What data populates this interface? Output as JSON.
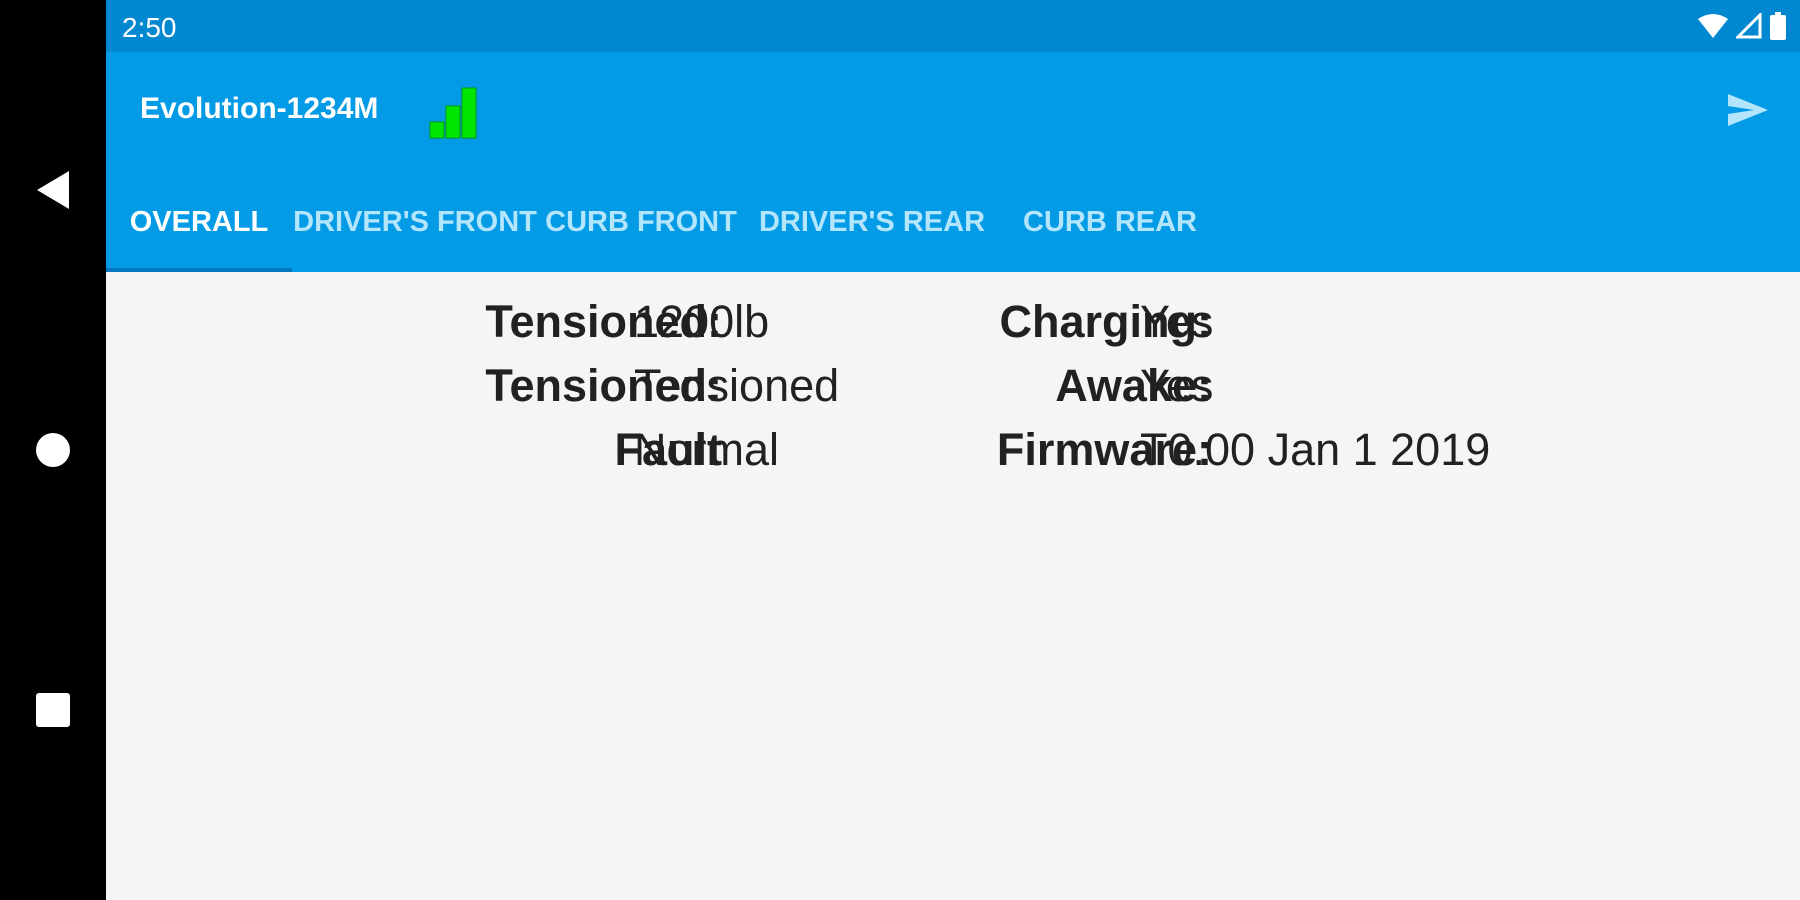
{
  "status_bar": {
    "time": "2:50",
    "icons": [
      "wifi-icon",
      "cell-signal-icon",
      "battery-icon"
    ]
  },
  "app_bar": {
    "title": "Evolution-1234M",
    "signal_icon": "signal-strength-icon",
    "signal_color": "#00e600",
    "action_icon": "send-icon"
  },
  "tabs": [
    {
      "label": "OVERALL",
      "active": true
    },
    {
      "label": "DRIVER'S FRONT",
      "active": false
    },
    {
      "label": "CURB FRONT",
      "active": false
    },
    {
      "label": "DRIVER'S REAR",
      "active": false
    },
    {
      "label": "CURB REAR",
      "active": false
    }
  ],
  "overall": {
    "rows": [
      {
        "label1": "Tensioned:",
        "value1": "1200lb",
        "label2": "Charging:",
        "value2": "Yes"
      },
      {
        "label1": "Tensioned:",
        "value1": "Tensioned",
        "label2": "Awake:",
        "value2": "Yes"
      },
      {
        "label1": "Fault",
        "value1": "Normal",
        "label2": "Firmware:",
        "value2": "T0.00 Jan 1 2019"
      }
    ]
  },
  "nav_bar": {
    "buttons": [
      "back-icon",
      "home-icon",
      "recents-icon"
    ]
  },
  "colors": {
    "status_bar": "#0288d1",
    "app_bar": "#039be5",
    "tab_inactive_text": "#b3e5fc",
    "background": "#f5f5f5"
  }
}
